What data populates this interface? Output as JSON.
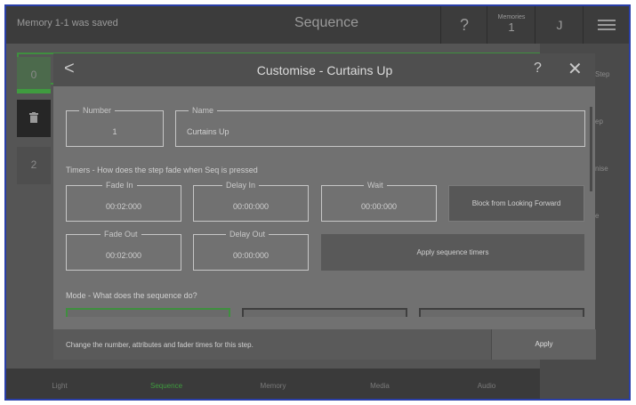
{
  "topbar": {
    "status": "Memory 1-1 was saved",
    "title": "Sequence",
    "help": "?",
    "memories_label": "Memories",
    "memories_value": "1",
    "user": "J"
  },
  "steps": {
    "first": "0",
    "second": "2"
  },
  "right_col": [
    "Step",
    "ep",
    "nise",
    "e"
  ],
  "bottom_nav": [
    "Light",
    "Sequence",
    "Memory",
    "Media",
    "Audio"
  ],
  "dialog": {
    "back": "<",
    "title": "Customise - Curtains Up",
    "help": "?",
    "close": "✕",
    "number_label": "Number",
    "number_value": "1",
    "name_label": "Name",
    "name_value": "Curtains Up",
    "timers_heading": "Timers - How does the step fade when Seq is pressed",
    "fade_in_label": "Fade In",
    "fade_in_value": "00:02:000",
    "delay_in_label": "Delay In",
    "delay_in_value": "00:00:000",
    "wait_label": "Wait",
    "wait_value": "00:00:000",
    "block_button": "Block from Looking Forward",
    "fade_out_label": "Fade Out",
    "fade_out_value": "00:02:000",
    "delay_out_label": "Delay Out",
    "delay_out_value": "00:00:000",
    "apply_timers_button": "Apply sequence timers",
    "mode_heading": "Mode - What does the sequence do?",
    "footer_hint": "Change the number, attributes and fader times for this step.",
    "apply_button": "Apply"
  },
  "colors": {
    "accent_green": "#3f9b3f",
    "frame_border": "#2a3fa8"
  }
}
